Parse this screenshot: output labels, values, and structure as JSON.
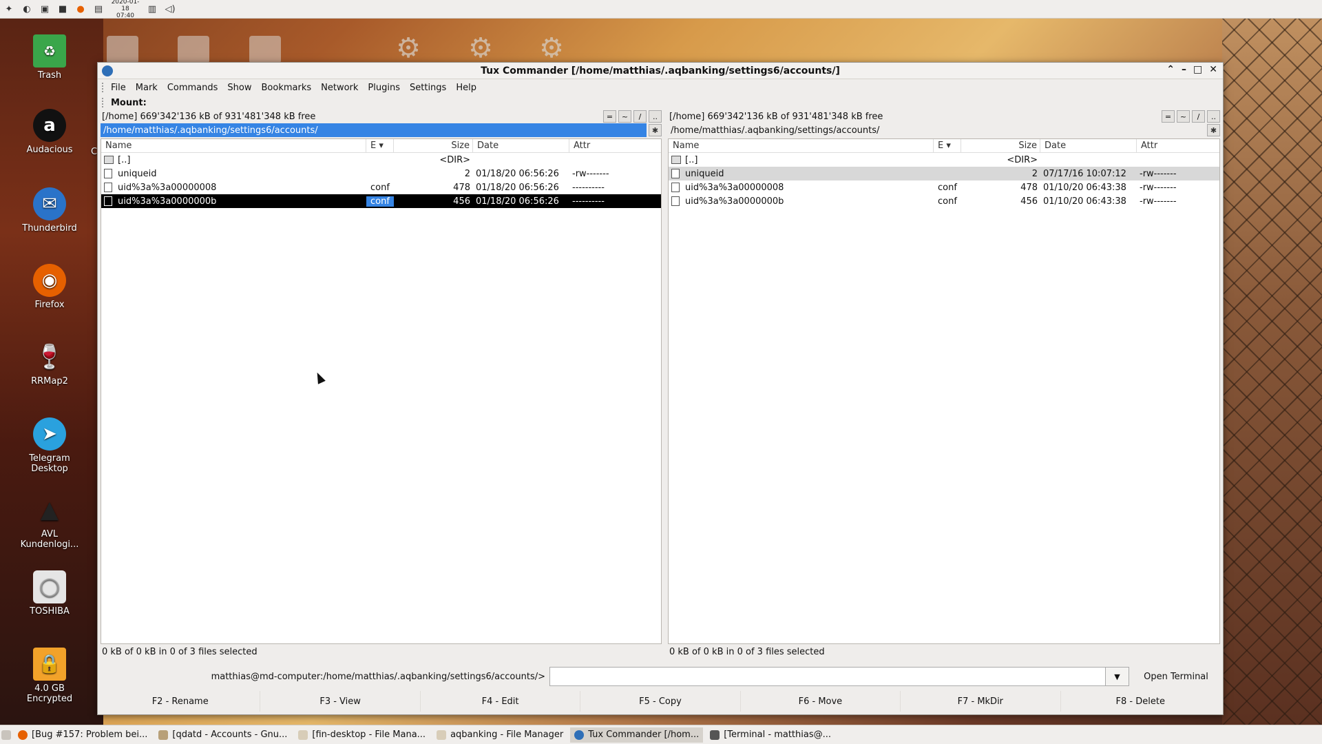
{
  "top_panel": {
    "clock_date": "2020-01-18",
    "clock_time": "07:40",
    "icons": [
      "menu-icon",
      "app-icon",
      "files-icon",
      "screen-icon",
      "firefox-icon",
      "terminal-icon",
      "network-icon",
      "volume-icon"
    ]
  },
  "desktop": {
    "icons": [
      {
        "label": "Trash"
      },
      {
        "label": "Audacious"
      },
      {
        "label": "Thunderbird"
      },
      {
        "label": "Firefox"
      },
      {
        "label": "RRMap2"
      },
      {
        "label": "Telegram Desktop"
      },
      {
        "label": "AVL Kundenlogi..."
      },
      {
        "label": "TOSHIBA"
      },
      {
        "label": "4.0 GB Encrypted"
      }
    ],
    "partial_label": "C"
  },
  "window": {
    "title": "Tux Commander  [/home/matthias/.aqbanking/settings6/accounts/]",
    "menu": [
      "File",
      "Mark",
      "Commands",
      "Show",
      "Bookmarks",
      "Network",
      "Plugins",
      "Settings",
      "Help"
    ],
    "mount_label": "Mount:"
  },
  "left_panel": {
    "free_info": "[/home]  669'342'136 kB of 931'481'348 kB free",
    "path": "/home/matthias/.aqbanking/settings6/accounts/",
    "headers": {
      "name": "Name",
      "ext": "E",
      "size": "Size",
      "date": "Date",
      "attr": "Attr"
    },
    "rows": [
      {
        "name": "[..]",
        "ext": "",
        "size": "<DIR>",
        "date": "",
        "attr": ""
      },
      {
        "name": "uniqueid",
        "ext": "",
        "size": "2",
        "date": "01/18/20 06:56:26",
        "attr": "-rw-------"
      },
      {
        "name": "uid%3a%3a00000008",
        "ext": "conf",
        "size": "478",
        "date": "01/18/20 06:56:26",
        "attr": "----------"
      },
      {
        "name": "uid%3a%3a0000000b",
        "ext": "conf",
        "size": "456",
        "date": "01/18/20 06:56:26",
        "attr": "----------"
      }
    ],
    "status": "0 kB of 0 kB in 0 of 3 files selected"
  },
  "right_panel": {
    "free_info": "[/home]  669'342'136 kB of 931'481'348 kB free",
    "path": "/home/matthias/.aqbanking/settings/accounts/",
    "headers": {
      "name": "Name",
      "ext": "E",
      "size": "Size",
      "date": "Date",
      "attr": "Attr"
    },
    "rows": [
      {
        "name": "[..]",
        "ext": "",
        "size": "<DIR>",
        "date": "",
        "attr": ""
      },
      {
        "name": "uniqueid",
        "ext": "",
        "size": "2",
        "date": "07/17/16 10:07:12",
        "attr": "-rw-------"
      },
      {
        "name": "uid%3a%3a00000008",
        "ext": "conf",
        "size": "478",
        "date": "01/10/20 06:43:38",
        "attr": "-rw-------"
      },
      {
        "name": "uid%3a%3a0000000b",
        "ext": "conf",
        "size": "456",
        "date": "01/10/20 06:43:38",
        "attr": "-rw-------"
      }
    ],
    "status": "0 kB of 0 kB in 0 of 3 files selected"
  },
  "panel_buttons": [
    "=",
    "~",
    "/",
    ".."
  ],
  "command_line": {
    "prompt": "matthias@md-computer:/home/matthias/.aqbanking/settings6/accounts/>",
    "value": "",
    "open_terminal": "Open Terminal"
  },
  "function_keys": [
    "F2 - Rename",
    "F3 - View",
    "F4 - Edit",
    "F5 - Copy",
    "F6 - Move",
    "F7 - MkDir",
    "F8 - Delete"
  ],
  "taskbar": {
    "items": [
      {
        "label": "[Bug #157: Problem bei..."
      },
      {
        "label": "[qdatd - Accounts - Gnu..."
      },
      {
        "label": "[fin-desktop - File Mana..."
      },
      {
        "label": "aqbanking - File Manager"
      },
      {
        "label": "Tux Commander  [/hom..."
      },
      {
        "label": "[Terminal - matthias@..."
      }
    ]
  },
  "colors": {
    "accent": "#3584e4",
    "selection": "#000000"
  }
}
